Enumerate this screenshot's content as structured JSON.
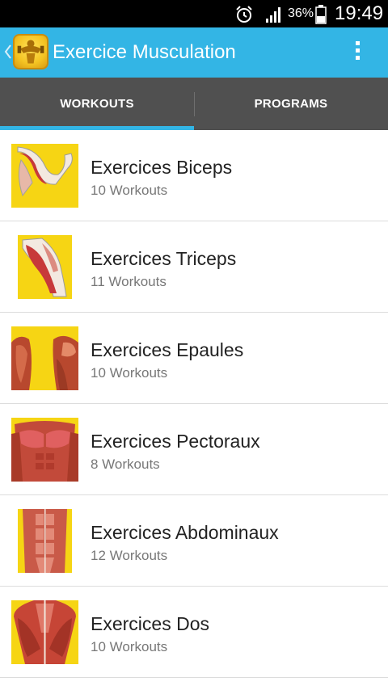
{
  "status_bar": {
    "battery_percent": "36%",
    "time": "19:49",
    "icons": [
      "alarm-icon",
      "signal-icon",
      "battery-icon"
    ]
  },
  "app_bar": {
    "title": "Exercice Musculation",
    "color": "#33b5e5",
    "icons": [
      "back-chevron-icon",
      "app-logo-icon",
      "overflow-menu-icon"
    ]
  },
  "tabs": [
    {
      "label": "WORKOUTS",
      "selected": true
    },
    {
      "label": "PROGRAMS",
      "selected": false
    }
  ],
  "categories": [
    {
      "title": "Exercices Biceps",
      "subtitle": "10 Workouts",
      "image": "biceps-muscle-illustration"
    },
    {
      "title": "Exercices Triceps",
      "subtitle": "11 Workouts",
      "image": "triceps-muscle-illustration"
    },
    {
      "title": "Exercices Epaules",
      "subtitle": "10 Workouts",
      "image": "shoulders-muscle-illustration"
    },
    {
      "title": "Exercices Pectoraux",
      "subtitle": "8 Workouts",
      "image": "chest-muscle-illustration"
    },
    {
      "title": "Exercices Abdominaux",
      "subtitle": "12 Workouts",
      "image": "abs-muscle-illustration"
    },
    {
      "title": "Exercices Dos",
      "subtitle": "10 Workouts",
      "image": "back-muscle-illustration"
    }
  ]
}
